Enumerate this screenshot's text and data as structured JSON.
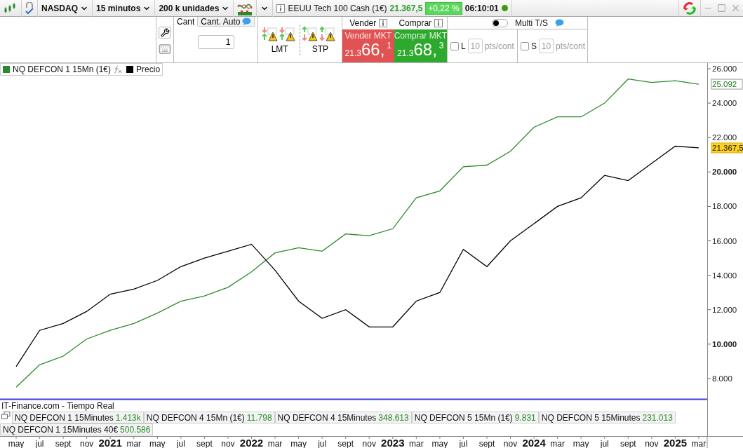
{
  "toolbar": {
    "market": "NASDAQ",
    "timeframe": "15 minutos",
    "size": "200 k unidades",
    "instrument": "EEUU Tech 100 Cash (1€)",
    "price": "21.367,5",
    "change": "+0,22 %",
    "time": "06:10:01"
  },
  "order_panel": {
    "quantity_tabs": [
      {
        "label": "Cant",
        "selected": true
      },
      {
        "label": "Cant. Auto",
        "selected": false
      }
    ],
    "quantity": "1",
    "order_types": [
      "LMT",
      "STP"
    ],
    "sell": {
      "header": "Vender",
      "label": "Vender MKT",
      "price_small": "21.3",
      "price_big": "66,",
      "price_sup": "1"
    },
    "buy": {
      "header": "Comprar",
      "label": "Comprar MKT",
      "price_small": "21.3",
      "price_big": "68,",
      "price_sup": "3"
    },
    "multi_ts": {
      "label": "Multi T/S",
      "on": false
    },
    "stops": [
      {
        "label": "L",
        "checked": false,
        "value": "10",
        "unit": "pts/cont"
      },
      {
        "label": "S",
        "checked": false,
        "value": "10",
        "unit": "pts/cont"
      }
    ]
  },
  "chart": {
    "source": "IT-Finance.com - Tiempo Real",
    "chart_data": {
      "type": "line",
      "categories": [
        "may",
        "jul",
        "sept",
        "nov",
        "2021",
        "mar",
        "may",
        "jul",
        "sept",
        "nov",
        "2022",
        "mar",
        "may",
        "jul",
        "sept",
        "nov",
        "2023",
        "mar",
        "may",
        "jul",
        "sept",
        "nov",
        "2024",
        "mar",
        "may",
        "jul",
        "sept",
        "nov",
        "2025",
        "mar"
      ],
      "series": [
        {
          "name": "NQ DEFCON 1 15Mn (1€)",
          "color": "#2a8a2a",
          "values": [
            7500,
            8800,
            9300,
            10300,
            10800,
            11200,
            11800,
            12500,
            12800,
            13300,
            14200,
            15300,
            15600,
            15400,
            16400,
            16300,
            16700,
            18500,
            18900,
            20300,
            20400,
            21200,
            22600,
            23200,
            23200,
            24000,
            25400,
            25200,
            25300,
            25100
          ]
        },
        {
          "name": "Precio",
          "color": "#000000",
          "values": [
            8700,
            10800,
            11200,
            11900,
            12900,
            13200,
            13700,
            14500,
            15000,
            15400,
            15800,
            14300,
            12500,
            11500,
            12000,
            11000,
            11000,
            12500,
            13000,
            15500,
            14500,
            16000,
            17000,
            18000,
            18500,
            19800,
            19500,
            20500,
            21500,
            21400
          ]
        }
      ],
      "legend": "upper left",
      "ylim": [
        4699,
        26325
      ],
      "ref_lines": [
        {
          "axis": "y",
          "value": 6800,
          "color": "#3c3cdc"
        }
      ],
      "yticks": [
        {
          "value": 26000,
          "label": "26.000"
        },
        {
          "value": 24000,
          "label": "24.000"
        },
        {
          "value": 22000,
          "label": "22.000"
        },
        {
          "value": 20000,
          "label": "20.000"
        },
        {
          "value": 18000,
          "label": "18.000"
        },
        {
          "value": 16000,
          "label": "16.000"
        },
        {
          "value": 14000,
          "label": "14.000"
        },
        {
          "value": 12000,
          "label": "12.000"
        },
        {
          "value": 10000,
          "label": "10.000"
        },
        {
          "value": 8000,
          "label": "8.000"
        }
      ],
      "annotations": [
        "25.092",
        "21.367,5"
      ]
    }
  },
  "indicator_rows": [
    [
      {
        "name": "NQ DEFCON 1 15Minutes",
        "value": "1.413k"
      },
      {
        "name": "NQ DEFCON 4 15Mn (1€)",
        "value": "11.798"
      },
      {
        "name": "NQ DEFCON 4 15Minutes",
        "value": "348.613"
      },
      {
        "name": "NQ DEFCON 5 15Mn (1€)",
        "value": "9.831"
      },
      {
        "name": "NQ DEFCON 5 15Minutes",
        "value": "231.013"
      }
    ],
    [
      {
        "name": "NQ DEFCON 1 15Minutes 40€",
        "value": "500.586"
      }
    ]
  ]
}
